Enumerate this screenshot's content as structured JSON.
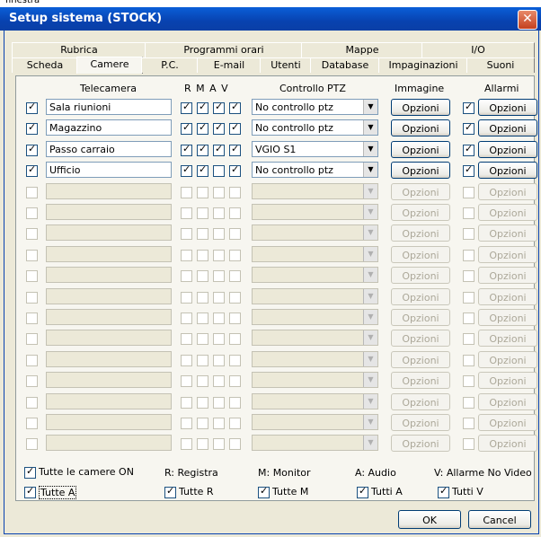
{
  "window": {
    "top_text": "finestra",
    "title": "Setup sistema (STOCK)",
    "close_glyph": "✕"
  },
  "tabs_back": [
    "Rubrica",
    "Programmi orari",
    "Mappe",
    "I/O"
  ],
  "tabs_front": [
    "Scheda",
    "Camere",
    "P.C.",
    "E-mail",
    "Utenti",
    "Database",
    "Impaginazioni",
    "Suoni"
  ],
  "active_tab": "Camere",
  "headers": {
    "telecamera": "Telecamera",
    "rmav": "R M A V",
    "ptz": "Controllo PTZ",
    "immagine": "Immagine",
    "allarmi": "Allarmi"
  },
  "cameras": [
    {
      "enabled": true,
      "name": "Sala riunioni",
      "r": true,
      "m": true,
      "a": true,
      "v": true,
      "ptz": "No controllo ptz",
      "alarm": true
    },
    {
      "enabled": true,
      "name": "Magazzino",
      "r": true,
      "m": true,
      "a": true,
      "v": true,
      "ptz": "No controllo ptz",
      "alarm": true
    },
    {
      "enabled": true,
      "name": "Passo carraio",
      "r": true,
      "m": true,
      "a": true,
      "v": true,
      "ptz": "VGIO S1",
      "alarm": true
    },
    {
      "enabled": true,
      "name": "Ufficio",
      "r": true,
      "m": true,
      "a": false,
      "v": true,
      "ptz": "No controllo ptz",
      "alarm": true
    },
    {
      "enabled": false,
      "name": "",
      "r": false,
      "m": false,
      "a": false,
      "v": false,
      "ptz": "",
      "alarm": false
    },
    {
      "enabled": false,
      "name": "",
      "r": false,
      "m": false,
      "a": false,
      "v": false,
      "ptz": "",
      "alarm": false
    },
    {
      "enabled": false,
      "name": "",
      "r": false,
      "m": false,
      "a": false,
      "v": false,
      "ptz": "",
      "alarm": false
    },
    {
      "enabled": false,
      "name": "",
      "r": false,
      "m": false,
      "a": false,
      "v": false,
      "ptz": "",
      "alarm": false
    },
    {
      "enabled": false,
      "name": "",
      "r": false,
      "m": false,
      "a": false,
      "v": false,
      "ptz": "",
      "alarm": false
    },
    {
      "enabled": false,
      "name": "",
      "r": false,
      "m": false,
      "a": false,
      "v": false,
      "ptz": "",
      "alarm": false
    },
    {
      "enabled": false,
      "name": "",
      "r": false,
      "m": false,
      "a": false,
      "v": false,
      "ptz": "",
      "alarm": false
    },
    {
      "enabled": false,
      "name": "",
      "r": false,
      "m": false,
      "a": false,
      "v": false,
      "ptz": "",
      "alarm": false
    },
    {
      "enabled": false,
      "name": "",
      "r": false,
      "m": false,
      "a": false,
      "v": false,
      "ptz": "",
      "alarm": false
    },
    {
      "enabled": false,
      "name": "",
      "r": false,
      "m": false,
      "a": false,
      "v": false,
      "ptz": "",
      "alarm": false
    },
    {
      "enabled": false,
      "name": "",
      "r": false,
      "m": false,
      "a": false,
      "v": false,
      "ptz": "",
      "alarm": false
    },
    {
      "enabled": false,
      "name": "",
      "r": false,
      "m": false,
      "a": false,
      "v": false,
      "ptz": "",
      "alarm": false
    },
    {
      "enabled": false,
      "name": "",
      "r": false,
      "m": false,
      "a": false,
      "v": false,
      "ptz": "",
      "alarm": false
    }
  ],
  "options_label": "Opzioni",
  "legend": {
    "all_on": "Tutte le camere ON",
    "r": "R: Registra",
    "m": "M: Monitor",
    "a": "A: Audio",
    "v": "V: Allarme No Video"
  },
  "bottom_checks": {
    "tutte_a": "Tutte A",
    "tutte_r": "Tutte R",
    "tutte_m": "Tutte M",
    "tutti_a": "Tutti A",
    "tutti_v": "Tutti V"
  },
  "buttons": {
    "ok": "OK",
    "cancel": "Cancel"
  },
  "colors": {
    "titlebar": "#0842b0",
    "check": "#21a121"
  }
}
